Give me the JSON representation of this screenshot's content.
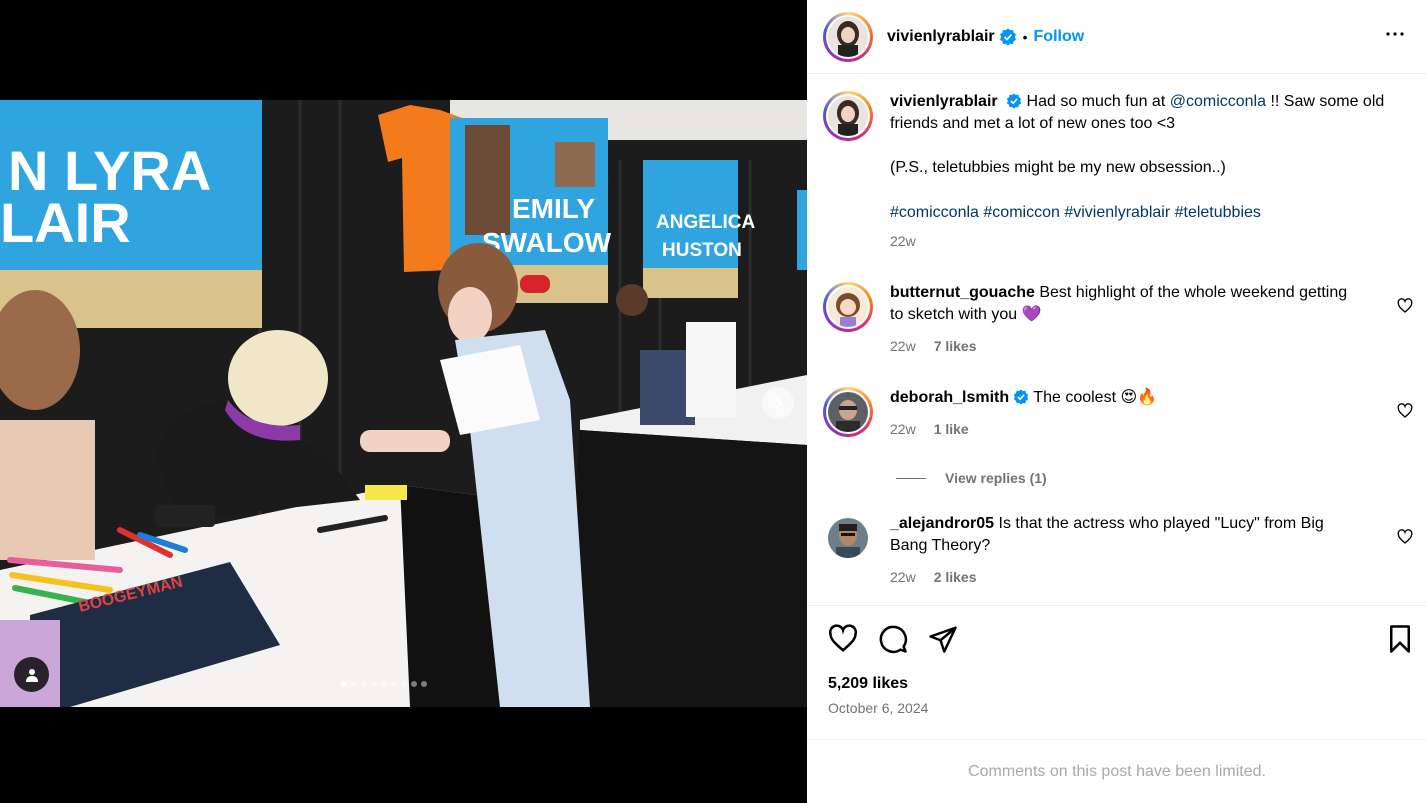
{
  "post": {
    "author": "vivienlyrablair",
    "follow_label": "Follow",
    "bullet": "•",
    "caption_text": "Had so much fun at ",
    "caption_mention": "@comicconla",
    "caption_after": " !! Saw some old friends and met a lot of new ones too <3",
    "caption_ps": "(P.S., teletubbies might be my new obsession..)",
    "hashtags": [
      "#comicconla",
      "#comiccon",
      "#vivienlyrablair",
      "#teletubbies"
    ],
    "caption_time": "22w",
    "likes": "5,209 likes",
    "date": "October 6, 2024",
    "comments_limited": "Comments on this post have been limited.",
    "carousel_count": 9,
    "carousel_index": 1
  },
  "photo_signage": {
    "banner_left": [
      "N LYRA",
      "LAIR"
    ],
    "banner_mid": [
      "EMILY",
      "SWALOW"
    ],
    "banner_right": [
      "ANGELICA",
      "HUSTON"
    ],
    "poster": "BOOGEYMAN"
  },
  "comments": [
    {
      "user": "butternut_gouache",
      "text": "Best highlight of the whole weekend getting to sketch with you 💜",
      "time": "22w",
      "likes": "7 likes",
      "verified": false
    },
    {
      "user": "deborah_lsmith",
      "text": "The coolest 😍🔥",
      "time": "22w",
      "likes": "1 like",
      "verified": true,
      "view_replies": "View replies (1)"
    },
    {
      "user": "_alejandror05",
      "text": "Is that the actress who played \"Lucy\" from Big Bang Theory?",
      "time": "22w",
      "likes": "2 likes",
      "verified": false
    }
  ],
  "colors": {
    "accent": "#0095f6",
    "verified": "#0095f6",
    "muted": "#737373",
    "link": "#00376b"
  },
  "icons": [
    "more-icon",
    "verified-icon",
    "heart-icon",
    "comment-icon",
    "share-icon",
    "bookmark-icon",
    "next-arrow-icon",
    "user-tag-icon"
  ]
}
